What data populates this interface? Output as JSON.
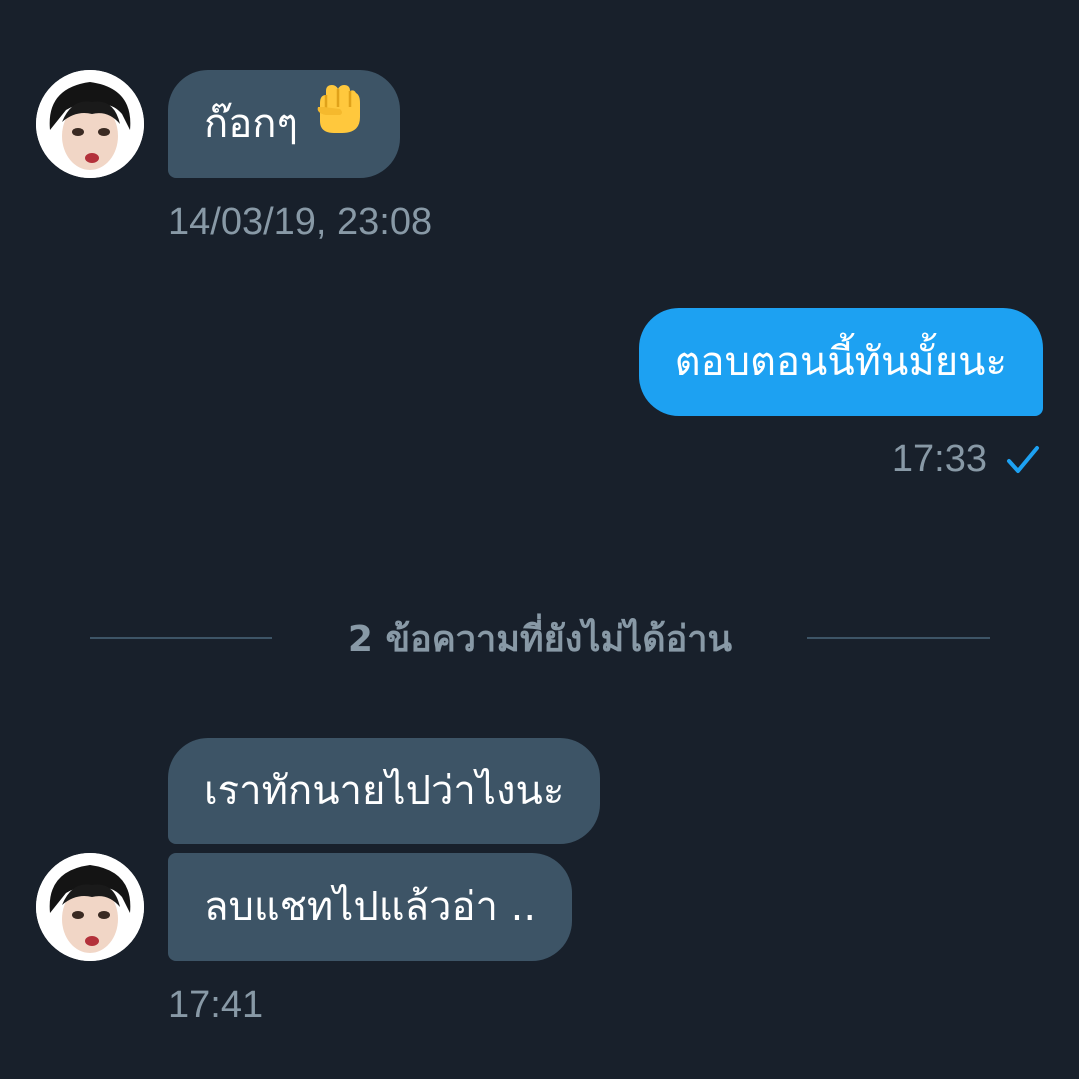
{
  "theme": {
    "background": "#18202b",
    "incoming_bubble": "#3d5466",
    "outgoing_bubble": "#1da1f2",
    "meta_text": "#8899a6",
    "read_check": "#1da1f2"
  },
  "messages": [
    {
      "direction": "incoming",
      "text": "ก๊อกๆ",
      "emoji": "raised-fist-icon",
      "timestamp": "14/03/19, 23:08"
    },
    {
      "direction": "outgoing",
      "text": "ตอบตอนนี้ทันมั้ยนะ",
      "timestamp": "17:33",
      "status_icon": "check-icon"
    }
  ],
  "unread_divider": {
    "label": "2 ข้อความที่ยังไม่ได้อ่าน"
  },
  "unread_messages": [
    {
      "direction": "incoming",
      "text": "เราทักนายไปว่าไงนะ"
    },
    {
      "direction": "incoming",
      "text": "ลบแชทไปแล้วอ่า ..",
      "timestamp": "17:41"
    }
  ]
}
